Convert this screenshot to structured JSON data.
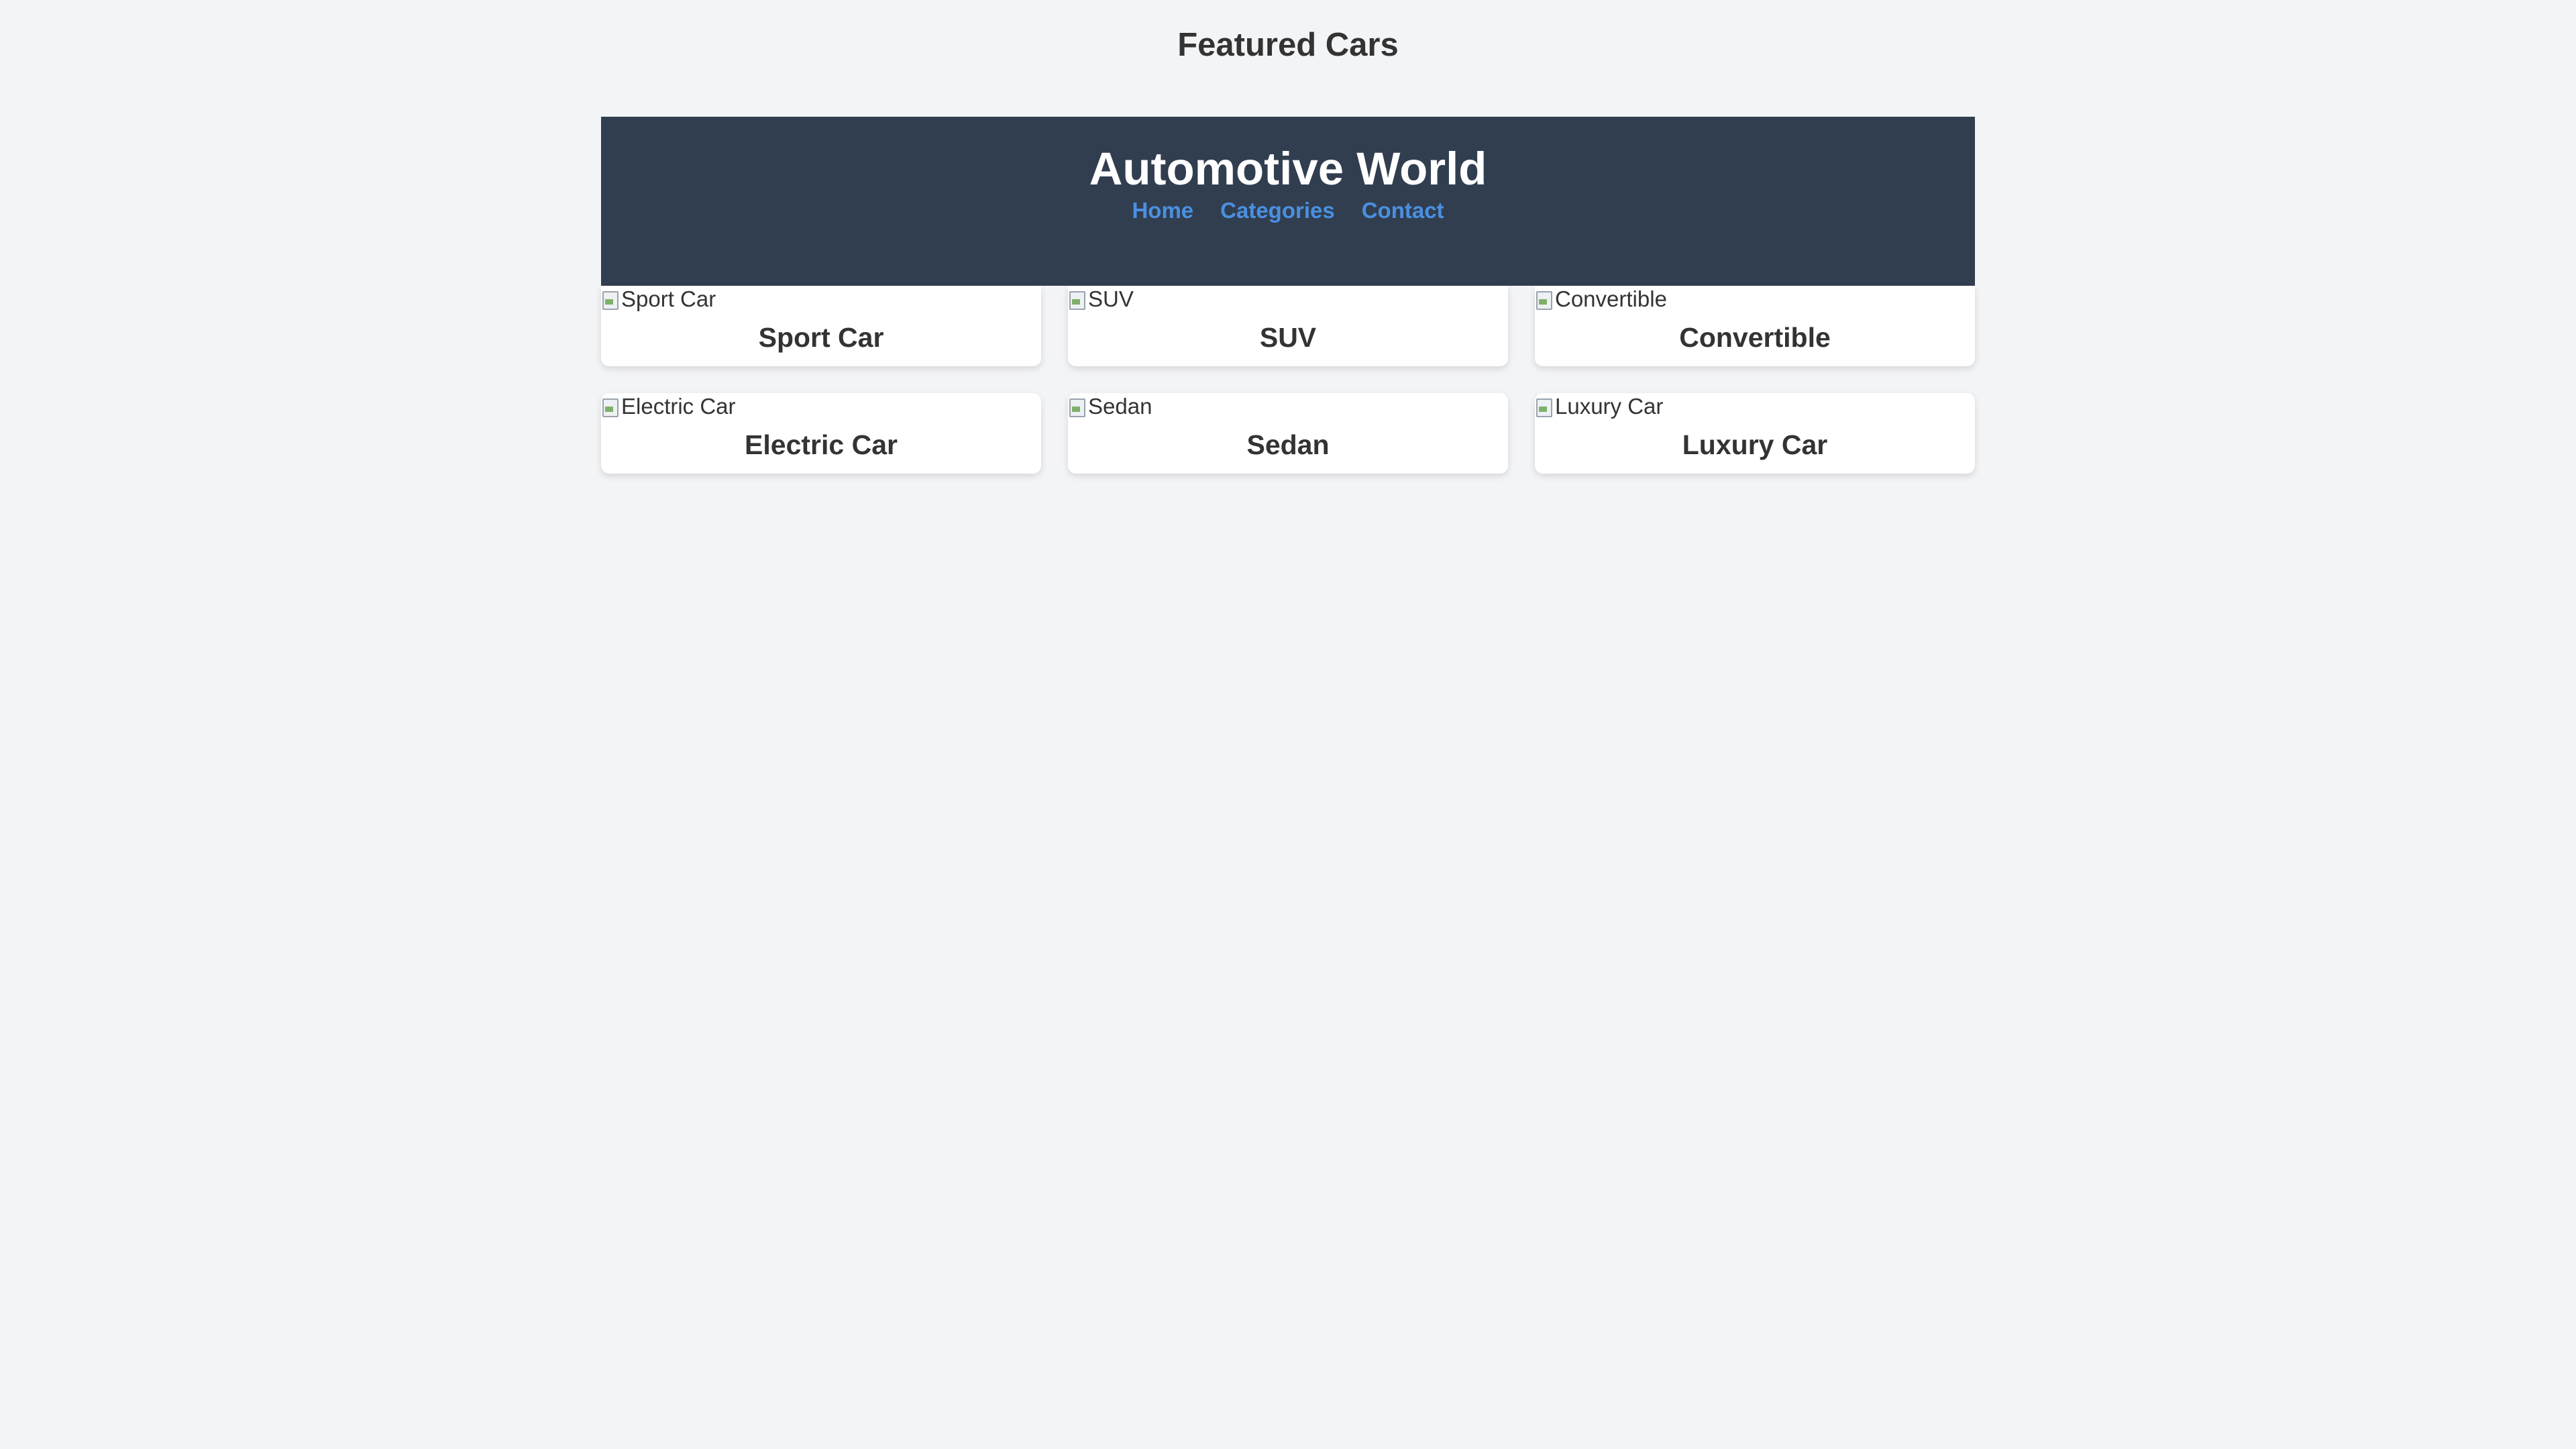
{
  "page": {
    "title": "Featured Cars"
  },
  "header": {
    "site_title": "Automotive World",
    "nav": [
      {
        "label": "Home"
      },
      {
        "label": "Categories"
      },
      {
        "label": "Contact"
      }
    ]
  },
  "cards": [
    {
      "alt": "Sport Car",
      "label": "Sport Car"
    },
    {
      "alt": "SUV",
      "label": "SUV"
    },
    {
      "alt": "Convertible",
      "label": "Convertible"
    },
    {
      "alt": "Electric Car",
      "label": "Electric Car"
    },
    {
      "alt": "Sedan",
      "label": "Sedan"
    },
    {
      "alt": "Luxury Car",
      "label": "Luxury Car"
    }
  ],
  "colors": {
    "background": "#f3f4f6",
    "header_bg": "#313e50",
    "nav_link": "#4a90e2",
    "card_bg": "#ffffff",
    "text": "#333333"
  }
}
